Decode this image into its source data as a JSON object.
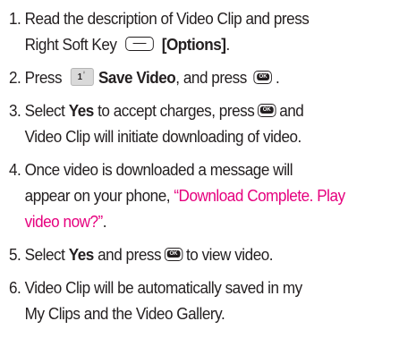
{
  "steps": [
    {
      "num": "1.",
      "lines": [
        "Read the description of Video Clip and press",
        "Right Soft Key"
      ],
      "options_label": "[Options]",
      "end": "."
    },
    {
      "num": "2.",
      "press": "Press",
      "save_video": "Save Video",
      "and_press": ", and press",
      "end": "."
    },
    {
      "num": "3.",
      "select": "Select",
      "yes": "Yes",
      "text_a": "to accept charges, press",
      "text_b": "and",
      "line2": "Video Clip will initiate downloading of video."
    },
    {
      "num": "4.",
      "line1": "Once video is downloaded a message will",
      "line2": "appear on your phone,",
      "highlight": "“Download Complete. Play video now?”",
      "end": "."
    },
    {
      "num": "5.",
      "select": "Select",
      "yes": "Yes",
      "and_press": "and press",
      "end": "to view video."
    },
    {
      "num": "6.",
      "line1": "Video Clip will be automatically saved in my",
      "line2": "My Clips and the Video Gallery."
    }
  ],
  "keys": {
    "soft_key": "right-soft-key-icon",
    "one_key": {
      "main": "1",
      "sub": "♀"
    },
    "ok_key": "OK"
  },
  "colors": {
    "text": "#231f20",
    "highlight": "#e6007e"
  }
}
